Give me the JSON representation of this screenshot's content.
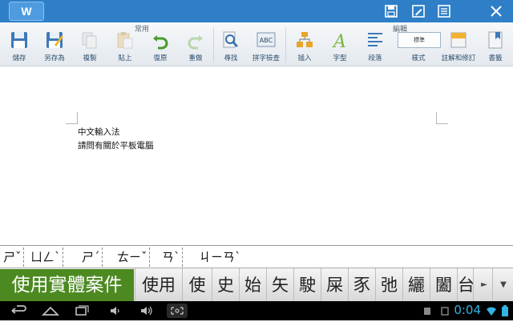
{
  "app": {
    "logo": "W"
  },
  "ribbon": {
    "groups": {
      "common": "常用",
      "edit": "編輯"
    },
    "buttons": {
      "save": "儲存",
      "save_as": "另存為",
      "copy": "複製",
      "paste": "貼上",
      "undo": "復原",
      "redo": "重做",
      "find": "尋找",
      "spellcheck": "拼字檢查",
      "insert": "插入",
      "font": "字型",
      "paragraph": "段落",
      "style": "樣式",
      "style_preview": "標準",
      "comments": "註解和修訂",
      "bookmark": "書籤"
    }
  },
  "document": {
    "lines": [
      "中文輸入法",
      "請問有關於平板電腦"
    ]
  },
  "ime": {
    "composing": [
      "ㄕˇ",
      "ㄩㄥˋ",
      "ㄕˊ",
      "ㄊㄧˇ",
      "ㄢˋ",
      "ㄐㄧㄢˋ"
    ],
    "selected": "使用實體案件",
    "candidates": [
      "使用",
      "使",
      "史",
      "始",
      "矢",
      "駛",
      "屎",
      "豕",
      "弛",
      "纚",
      "闔",
      "台"
    ]
  },
  "status": {
    "time": "0:04"
  },
  "colors": {
    "titlebar": "#2f7fc8",
    "ime_highlight": "#4c8a21",
    "clock": "#33b5e5"
  }
}
